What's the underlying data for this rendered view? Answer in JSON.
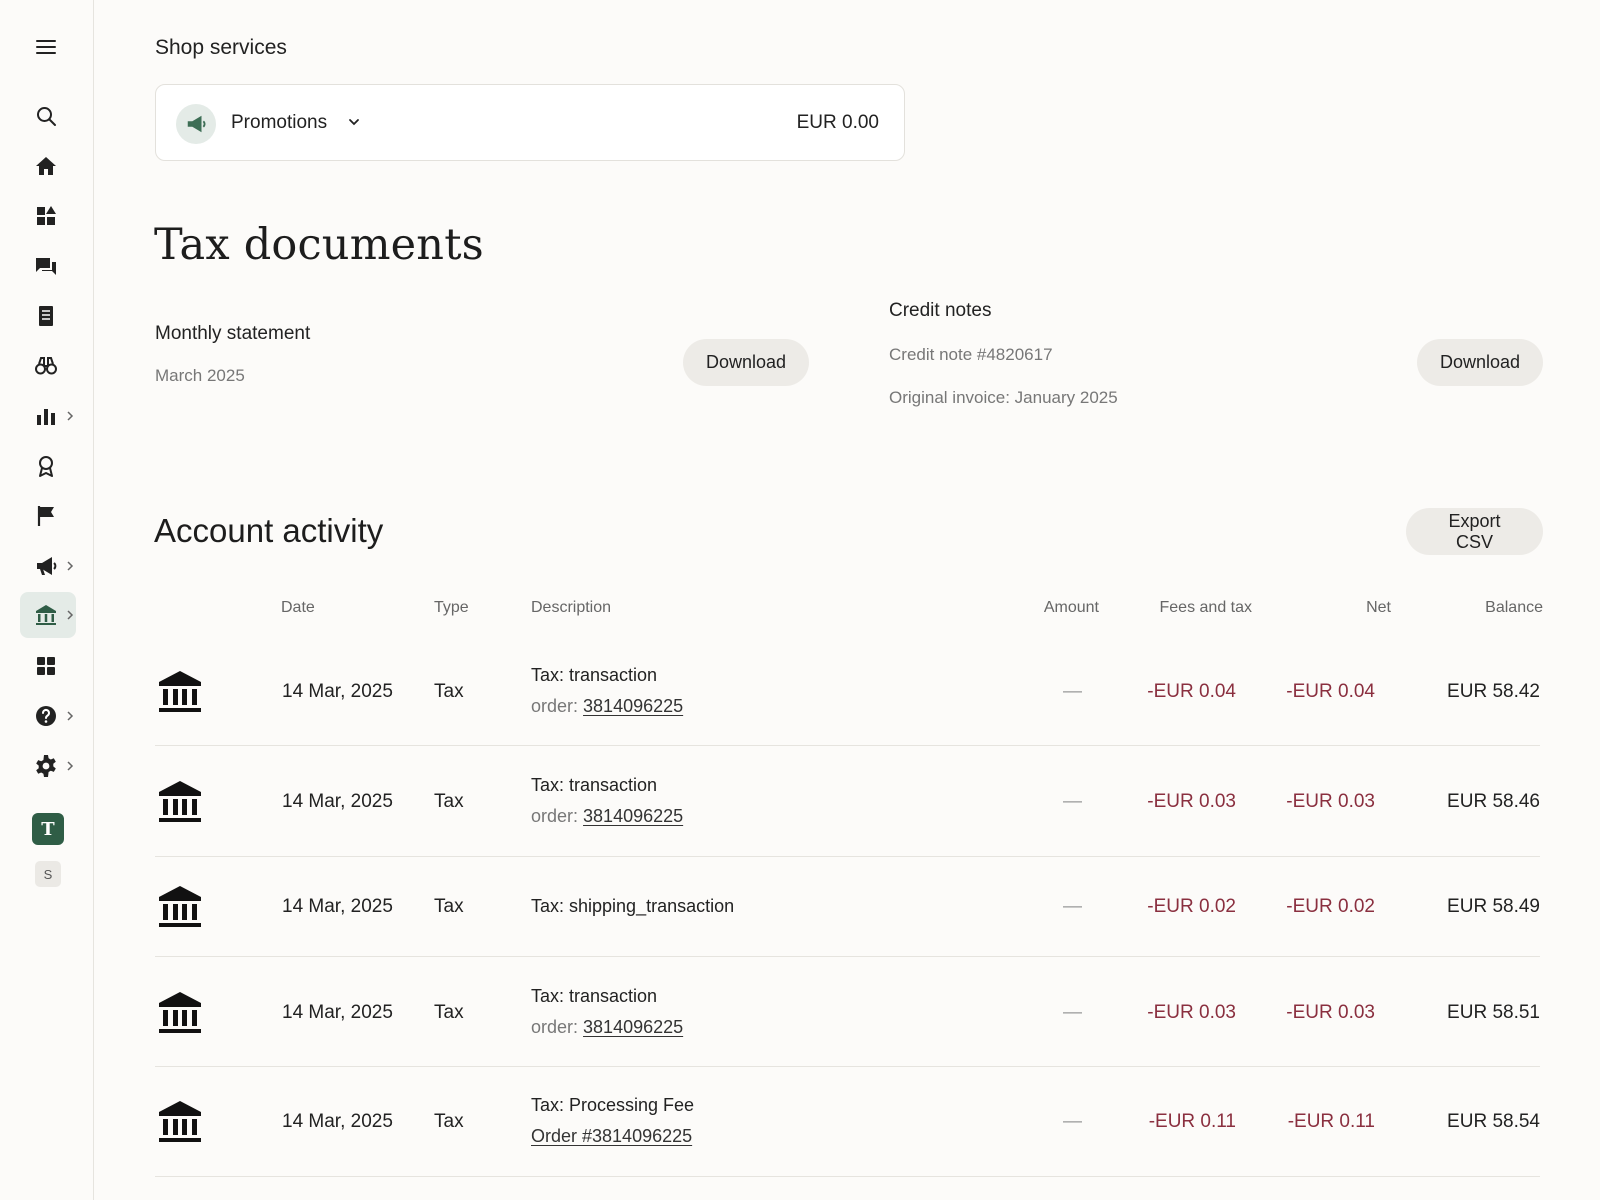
{
  "sidebar": {
    "icons": [
      "menu-icon",
      "search-icon",
      "home-icon",
      "dashboard-icon",
      "messages-icon",
      "orders-icon",
      "binoculars-icon",
      "stats-icon",
      "badge-icon",
      "flag-icon",
      "megaphone-icon",
      "bank-icon",
      "apps-icon",
      "help-icon",
      "gear-icon"
    ],
    "shop_badge_primary": "T",
    "shop_badge_secondary": "S",
    "accent_color": "#2f5d46"
  },
  "shop_services": {
    "label": "Shop services",
    "promo": {
      "title": "Promotions",
      "amount": "EUR 0.00"
    }
  },
  "tax_documents": {
    "title": "Tax documents",
    "monthly_statement": {
      "title": "Monthly statement",
      "period": "March 2025",
      "button": "Download"
    },
    "credit_notes": {
      "title": "Credit notes",
      "note": "Credit note #4820617",
      "original": "Original invoice: January 2025",
      "button": "Download"
    }
  },
  "account_activity": {
    "title": "Account activity",
    "export_button": "Export CSV",
    "columns": {
      "date": "Date",
      "type": "Type",
      "description": "Description",
      "amount": "Amount",
      "fees": "Fees and tax",
      "net": "Net",
      "balance": "Balance"
    },
    "rows": [
      {
        "date": "14 Mar, 2025",
        "type": "Tax",
        "desc": "Tax: transaction",
        "sub_prefix": "order: ",
        "sub_link": "3814096225",
        "amount": "—",
        "fees": "-EUR 0.04",
        "net": "-EUR 0.04",
        "balance": "EUR 58.42"
      },
      {
        "date": "14 Mar, 2025",
        "type": "Tax",
        "desc": "Tax: transaction",
        "sub_prefix": "order: ",
        "sub_link": "3814096225",
        "amount": "—",
        "fees": "-EUR 0.03",
        "net": "-EUR 0.03",
        "balance": "EUR 58.46"
      },
      {
        "date": "14 Mar, 2025",
        "type": "Tax",
        "desc": "Tax: shipping_transaction",
        "sub_prefix": "",
        "sub_link": "",
        "amount": "—",
        "fees": "-EUR 0.02",
        "net": "-EUR 0.02",
        "balance": "EUR 58.49"
      },
      {
        "date": "14 Mar, 2025",
        "type": "Tax",
        "desc": "Tax: transaction",
        "sub_prefix": "order: ",
        "sub_link": "3814096225",
        "amount": "—",
        "fees": "-EUR 0.03",
        "net": "-EUR 0.03",
        "balance": "EUR 58.51"
      },
      {
        "date": "14 Mar, 2025",
        "type": "Tax",
        "desc": "Tax: Processing Fee",
        "sub_prefix": "",
        "sub_link": "Order #3814096225",
        "amount": "—",
        "fees": "-EUR 0.11",
        "net": "-EUR 0.11",
        "balance": "EUR 58.54"
      }
    ],
    "negative_color": "#8a2f3f"
  }
}
